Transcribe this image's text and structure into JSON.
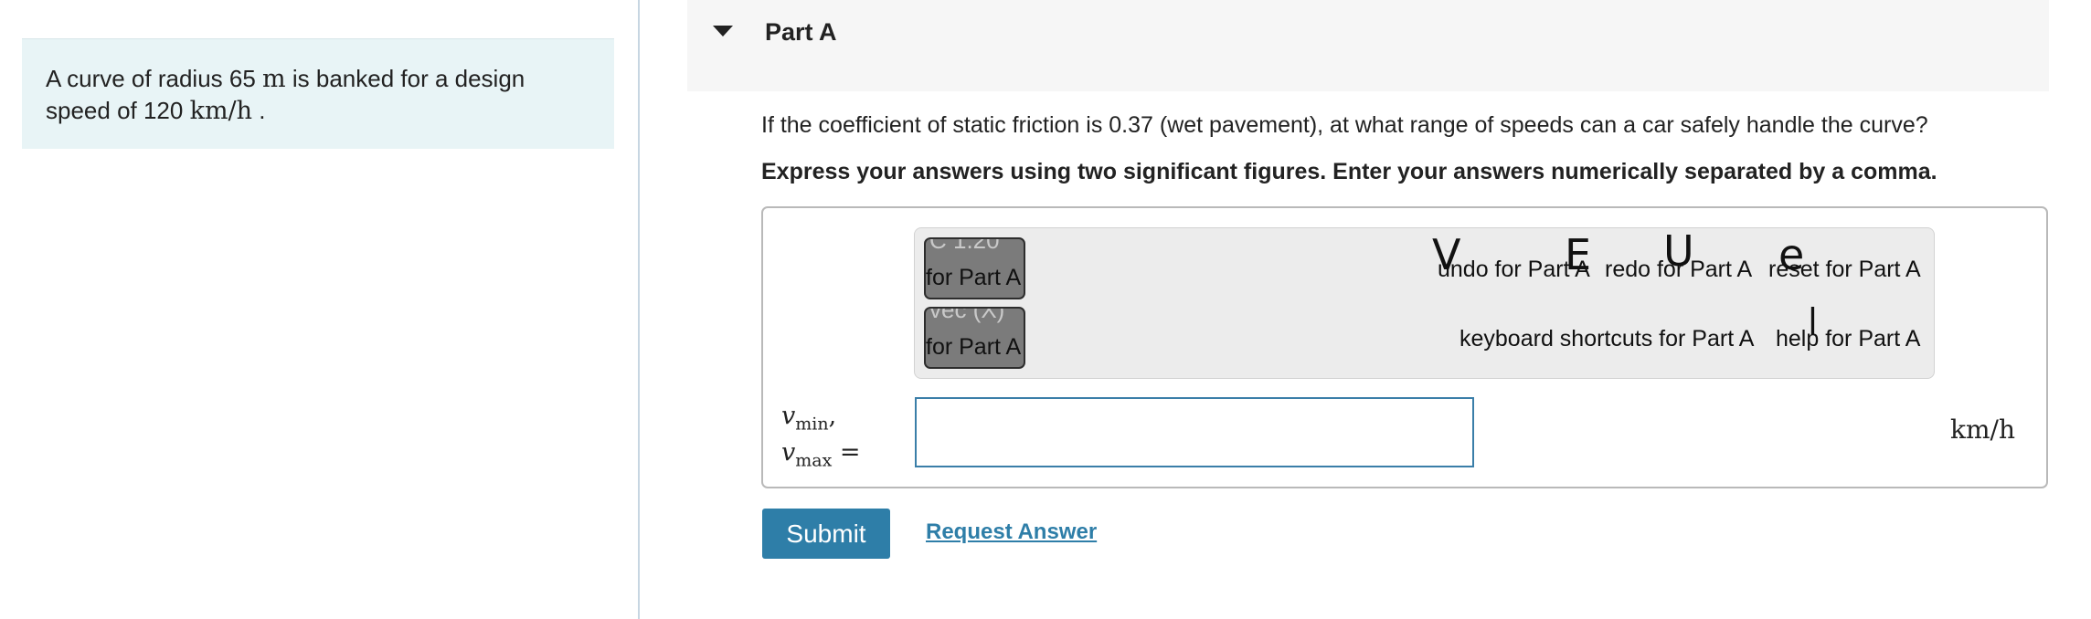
{
  "problem": {
    "text_before_radius": "A curve of radius 65 ",
    "radius_unit": "m",
    "text_mid": " is banked for a design speed of 120 ",
    "speed_unit": "km/h",
    "text_end": " ."
  },
  "part": {
    "title": "Part A",
    "question": "If the coefficient of static friction is 0.37 (wet pavement), at what range of speeds can a car safely handle the curve?",
    "instructions": "Express your answers using two significant figures. Enter your answers numerically separated by a comma."
  },
  "toolbar": {
    "button1_label": "for Part A",
    "button1_ghost": "C  1.20",
    "button2_label": "for Part A",
    "button2_ghost": "vec (X)",
    "undo": "undo for Part A",
    "redo": "redo for Part A",
    "reset": "reset for Part A",
    "keyboard": "keyboard shortcuts for Part A",
    "help": "help for Part A"
  },
  "answer": {
    "var1": "v",
    "var1_sub": "min",
    "var2": "v",
    "var2_sub": "max",
    "separator": ",",
    "equals": "=",
    "value": "",
    "unit": "km/h"
  },
  "actions": {
    "submit": "Submit",
    "request_answer": "Request Answer"
  }
}
